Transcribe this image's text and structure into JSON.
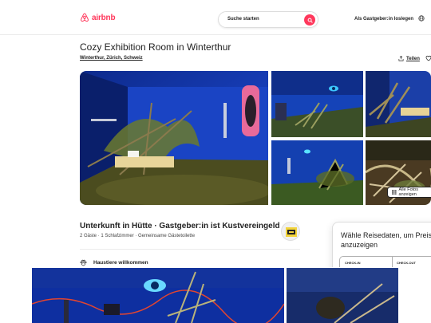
{
  "header": {
    "brand": "airbnb",
    "search_label": "Suche starten",
    "host_link": "Als Gastgeber:in loslegen",
    "brand_color": "#ff385c"
  },
  "listing": {
    "title": "Cozy Exhibition Room in Winterthur",
    "location": "Winterthur, Zürich, Schweiz",
    "share_label": "Teilen",
    "show_all_photos": "Alle Fotos anzeigen",
    "subtitle": "Unterkunft in Hütte · Gastgeber:in ist Kustvereingeld",
    "details": "2 Gäste · 1 Schlafzimmer · Gemeinsame Gästetoilette",
    "amenity_pets": "Haustiere willkommen"
  },
  "booking": {
    "title": "Wähle Reisedaten, um Preise anzuzeigen",
    "checkin_label": "CHECK-IN",
    "checkout_label": "CHECK-OUT"
  },
  "icons": {
    "logo": "airbnb-logo-icon",
    "search": "search-icon",
    "globe": "globe-icon",
    "share": "share-icon",
    "heart": "heart-icon",
    "grid": "grid-icon",
    "paw": "paw-icon"
  }
}
